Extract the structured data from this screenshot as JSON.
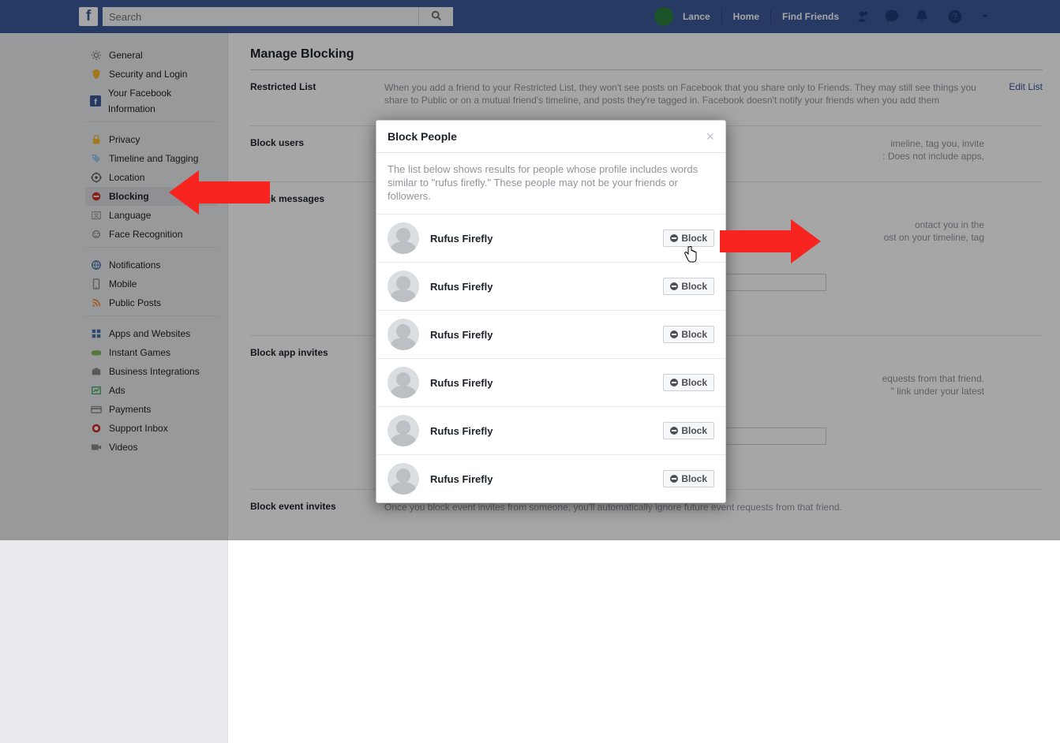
{
  "topbar": {
    "search_placeholder": "Search",
    "user_name": "Lance",
    "home": "Home",
    "find_friends": "Find Friends"
  },
  "sidebar": {
    "group1": [
      {
        "icon": "gear",
        "label": "General"
      },
      {
        "icon": "shield",
        "label": "Security and Login"
      },
      {
        "icon": "fb",
        "label": "Your Facebook Information"
      }
    ],
    "group2": [
      {
        "icon": "lock",
        "label": "Privacy"
      },
      {
        "icon": "tag",
        "label": "Timeline and Tagging"
      },
      {
        "icon": "location",
        "label": "Location"
      },
      {
        "icon": "block",
        "label": "Blocking",
        "selected": true
      },
      {
        "icon": "lang",
        "label": "Language"
      },
      {
        "icon": "face",
        "label": "Face Recognition"
      }
    ],
    "group3": [
      {
        "icon": "globe",
        "label": "Notifications"
      },
      {
        "icon": "mobile",
        "label": "Mobile"
      },
      {
        "icon": "rss",
        "label": "Public Posts"
      }
    ],
    "group4": [
      {
        "icon": "apps",
        "label": "Apps and Websites"
      },
      {
        "icon": "games",
        "label": "Instant Games"
      },
      {
        "icon": "biz",
        "label": "Business Integrations"
      },
      {
        "icon": "ads",
        "label": "Ads"
      },
      {
        "icon": "card",
        "label": "Payments"
      },
      {
        "icon": "inbox",
        "label": "Support Inbox"
      },
      {
        "icon": "video",
        "label": "Videos"
      }
    ]
  },
  "main": {
    "title": "Manage Blocking",
    "sections": {
      "restricted": {
        "label": "Restricted List",
        "body": "When you add a friend to your Restricted List, they won't see posts on Facebook that you share only to Friends. They may still see things you share to Public or on a mutual friend's timeline, and posts they're tagged in. Facebook doesn't notify your friends when you add them",
        "action": "Edit List"
      },
      "block_users": {
        "label": "Block users",
        "body_suffix": "imeline, tag you, invite\n: Does not include apps,"
      },
      "block_messages": {
        "label": "Block messages",
        "body_suffix": "ontact you in the\nost on your timeline, tag"
      },
      "block_app_invites": {
        "label": "Block app invites",
        "body_suffix": "equests from that friend.\n\" link under your latest"
      },
      "block_event_invites": {
        "label": "Block event invites",
        "body": "Once you block event invites from someone, you'll automatically ignore future event requests from that friend."
      }
    }
  },
  "modal": {
    "title": "Block People",
    "description": "The list below shows results for people whose profile includes words similar to \"rufus firefly.\" These people may not be your friends or followers.",
    "block_label": "Block",
    "results": [
      {
        "name": "Rufus Firefly"
      },
      {
        "name": "Rufus Firefly"
      },
      {
        "name": "Rufus Firefly"
      },
      {
        "name": "Rufus Firefly"
      },
      {
        "name": "Rufus Firefly"
      },
      {
        "name": "Rufus Firefly"
      }
    ]
  }
}
